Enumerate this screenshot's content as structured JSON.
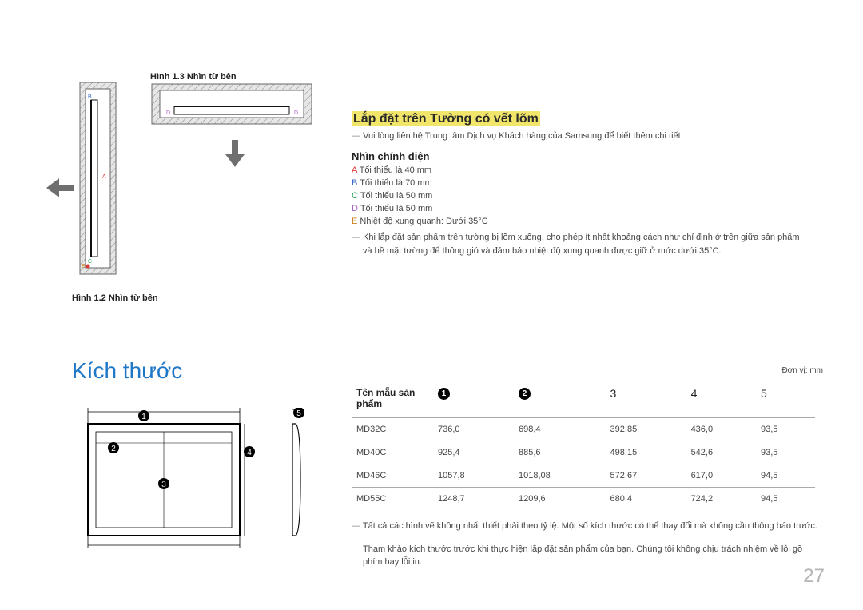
{
  "fig13_label": "Hình 1.3 Nhìn từ bên",
  "fig12_label": "Hình 1.2 Nhìn từ bên",
  "diagram": {
    "A": "A",
    "B": "B",
    "C": "C",
    "D": "D",
    "E": "E"
  },
  "install": {
    "title": "Lắp đặt trên Tường có vết lõm",
    "contact_note_prefix": "―",
    "contact_note": "Vui lòng liên hệ Trung tâm Dịch vụ Khách hàng của Samsung để biết thêm chi tiết.",
    "sub_head": "Nhìn chính diện",
    "A_label": "A",
    "A_text": "Tối thiểu là 40 mm",
    "B_label": "B",
    "B_text": "Tối thiểu là 70 mm",
    "C_label": "C",
    "C_text": "Tối thiểu là 50 mm",
    "D_label": "D",
    "D_text": "Tối thiểu là 50 mm",
    "E_label": "E",
    "E_text": "Nhiệt độ xung quanh: Dưới 35°C",
    "long_note_prefix": "―",
    "long_note": "Khi lắp đặt sản phẩm trên tường bị lõm xuống, cho phép ít nhất khoảng cách như chỉ định ở trên giữa sản phẩm và bề mặt tường để thông gió và đảm bảo nhiệt độ xung quanh được giữ ở mức dưới 35°C."
  },
  "dims_section_title": "Kích thước",
  "dims": {
    "unit": "Đơn vị: mm",
    "header": {
      "model": "Tên mẫu sản phẩm",
      "c1": "1",
      "c2": "2",
      "c3": "3",
      "c4": "4",
      "c5": "5"
    },
    "rows": [
      {
        "model": "MD32C",
        "v1": "736,0",
        "v2": "698,4",
        "v3": "392,85",
        "v4": "436,0",
        "v5": "93,5"
      },
      {
        "model": "MD40C",
        "v1": "925,4",
        "v2": "885,6",
        "v3": "498,15",
        "v4": "542,6",
        "v5": "93,5"
      },
      {
        "model": "MD46C",
        "v1": "1057,8",
        "v2": "1018,08",
        "v3": "572,67",
        "v4": "617,0",
        "v5": "94,5"
      },
      {
        "model": "MD55C",
        "v1": "1248,7",
        "v2": "1209,6",
        "v3": "680,4",
        "v4": "724,2",
        "v5": "94,5"
      }
    ],
    "footnote_prefix": "―",
    "footnote1": "Tất cả các hình vẽ không nhất thiết phải theo tỷ lệ. Một số kích thước có thể thay đổi mà không cần thông báo trước.",
    "footnote2": "Tham khảo kích thước trước khi thực hiện lắp đặt sản phẩm của bạn. Chúng tôi không chịu trách nhiệm về lỗi gõ phím hay lỗi in."
  },
  "page_number": "27"
}
